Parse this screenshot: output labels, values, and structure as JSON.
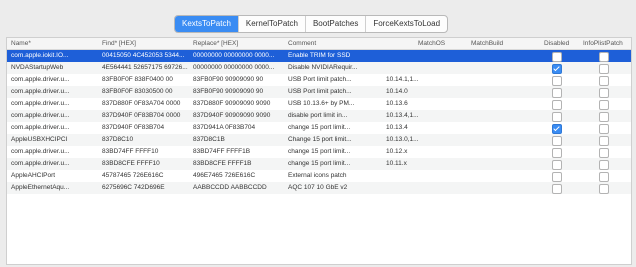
{
  "tabs": [
    "KextsToPatch",
    "KernelToPatch",
    "BootPatches",
    "ForceKextsToLoad"
  ],
  "active_tab": 0,
  "columns": [
    "Name*",
    "Find* [HEX]",
    "Replace* [HEX]",
    "Comment",
    "MatchOS",
    "MatchBuild",
    "Disabled",
    "InfoPlistPatch"
  ],
  "rows": [
    {
      "name": "com.apple.iokit.IO...",
      "find": "00415050 4C452053 5344...",
      "replace": "00000000 00000000 0000...",
      "comment": "Enable TRIM for SSD",
      "matchos": "",
      "matchbuild": "",
      "disabled": false,
      "infoplist": false
    },
    {
      "name": "NVDAStartupWeb",
      "find": "4E564441 52657175 69726...",
      "replace": "00000000 00000000 0000...",
      "comment": "Disable NVIDIARequir...",
      "matchos": "",
      "matchbuild": "",
      "disabled": true,
      "infoplist": false
    },
    {
      "name": "com.apple.driver.u...",
      "find": "83FB0F0F 838F0400 00",
      "replace": "83FB0F90 90909090 90",
      "comment": "USB Port limit patch...",
      "matchos": "10.14.1,1...",
      "matchbuild": "",
      "disabled": false,
      "infoplist": false
    },
    {
      "name": "com.apple.driver.u...",
      "find": "83FB0F0F 83030500 00",
      "replace": "83FB0F90 90909090 90",
      "comment": "USB Port limit patch...",
      "matchos": "10.14.0",
      "matchbuild": "",
      "disabled": false,
      "infoplist": false
    },
    {
      "name": "com.apple.driver.u...",
      "find": "837D880F 0F83A704 0000",
      "replace": "837D880F 90909090 9090",
      "comment": "USB 10.13.6+ by PM...",
      "matchos": "10.13.6",
      "matchbuild": "",
      "disabled": false,
      "infoplist": false
    },
    {
      "name": "com.apple.driver.u...",
      "find": "837D940F 0F83B704 0000",
      "replace": "837D940F 90909090 9090",
      "comment": "disable port limit in...",
      "matchos": "10.13.4,1...",
      "matchbuild": "",
      "disabled": false,
      "infoplist": false
    },
    {
      "name": "com.apple.driver.u...",
      "find": "837D940F 0F83B704",
      "replace": "837D941A 0F83B704",
      "comment": "change 15 port limit...",
      "matchos": "10.13.4",
      "matchbuild": "",
      "disabled": true,
      "infoplist": false
    },
    {
      "name": "AppleUSBXHCIPCI",
      "find": "837D8C10",
      "replace": "837D8C1B",
      "comment": "Change 15 port limit...",
      "matchos": "10.13.0,1...",
      "matchbuild": "",
      "disabled": false,
      "infoplist": false
    },
    {
      "name": "com.apple.driver.u...",
      "find": "83BD74FF FFFF10",
      "replace": "83BD74FF FFFF1B",
      "comment": "change 15 port limit...",
      "matchos": "10.12.x",
      "matchbuild": "",
      "disabled": false,
      "infoplist": false
    },
    {
      "name": "com.apple.driver.u...",
      "find": "83BD8CFE FFFF10",
      "replace": "83BD8CFE FFFF1B",
      "comment": "change 15 port limit...",
      "matchos": "10.11.x",
      "matchbuild": "",
      "disabled": false,
      "infoplist": false
    },
    {
      "name": "AppleAHCIPort",
      "find": "45787465 726E616C",
      "replace": "496E7465 726E616C",
      "comment": "External icons patch",
      "matchos": "",
      "matchbuild": "",
      "disabled": false,
      "infoplist": false
    },
    {
      "name": "AppleEthernetAqu...",
      "find": "6275696C 742D696E",
      "replace": "AABBCCDD AABBCCDD",
      "comment": "AQC 107 10 GbE v2",
      "matchos": "",
      "matchbuild": "",
      "disabled": false,
      "infoplist": false
    }
  ],
  "selected_row": 0
}
